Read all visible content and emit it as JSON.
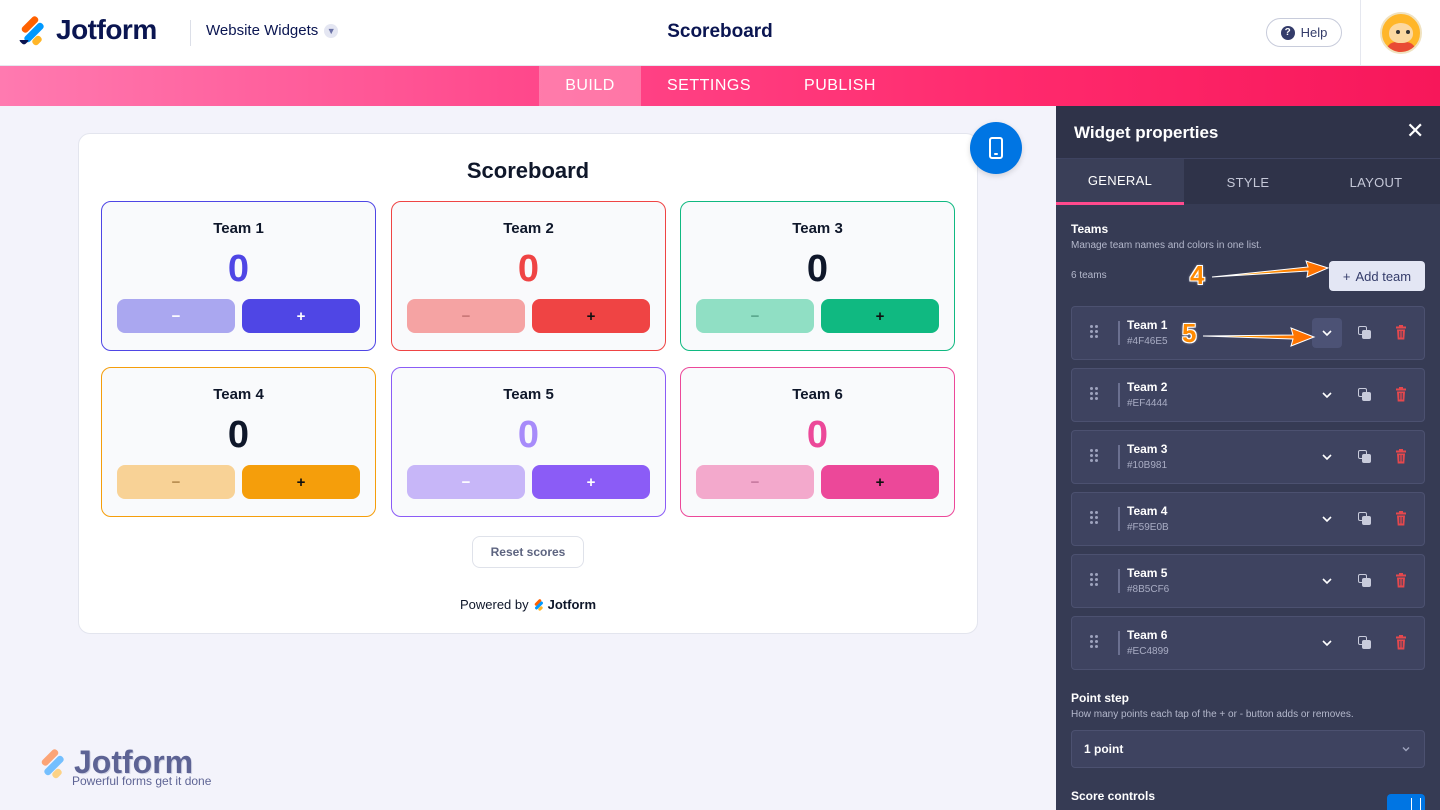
{
  "header": {
    "brand": "Jotform",
    "section": "Website Widgets",
    "title": "Scoreboard",
    "help_label": "Help"
  },
  "nav": {
    "tabs": [
      {
        "label": "BUILD",
        "active": true
      },
      {
        "label": "SETTINGS",
        "active": false
      },
      {
        "label": "PUBLISH",
        "active": false
      }
    ]
  },
  "widget": {
    "title": "Scoreboard",
    "teams": [
      {
        "name": "Team 1",
        "score": "0",
        "color": "#4F46E5",
        "minus": "−",
        "plus": "+"
      },
      {
        "name": "Team 2",
        "score": "0",
        "color": "#EF4444",
        "minus": "−",
        "plus": "+"
      },
      {
        "name": "Team 3",
        "score": "0",
        "color": "#10B981",
        "minus": "−",
        "plus": "+"
      },
      {
        "name": "Team 4",
        "score": "0",
        "color": "#F59E0B",
        "minus": "−",
        "plus": "+"
      },
      {
        "name": "Team 5",
        "score": "0",
        "color": "#8B5CF6",
        "minus": "−",
        "plus": "+"
      },
      {
        "name": "Team 6",
        "score": "0",
        "color": "#EC4899",
        "minus": "−",
        "plus": "+"
      }
    ],
    "reset_label": "Reset scores",
    "powered_prefix": "Powered by",
    "powered_brand": "Jotform"
  },
  "watermark": {
    "brand": "Jotform",
    "tagline": "Powerful forms get it done"
  },
  "panel": {
    "title": "Widget properties",
    "tabs": [
      {
        "label": "GENERAL",
        "active": true
      },
      {
        "label": "STYLE",
        "active": false
      },
      {
        "label": "LAYOUT",
        "active": false
      }
    ],
    "teams_section": {
      "title": "Teams",
      "subtitle": "Manage team names and colors in one list.",
      "count": "6 teams",
      "add_label": "Add team"
    },
    "team_rows": [
      {
        "name": "Team 1",
        "hex": "#4F46E5"
      },
      {
        "name": "Team 2",
        "hex": "#EF4444"
      },
      {
        "name": "Team 3",
        "hex": "#10B981"
      },
      {
        "name": "Team 4",
        "hex": "#F59E0B"
      },
      {
        "name": "Team 5",
        "hex": "#8B5CF6"
      },
      {
        "name": "Team 6",
        "hex": "#EC4899"
      }
    ],
    "point_step": {
      "title": "Point step",
      "subtitle": "How many points each tap of the + or - button adds or removes.",
      "value": "1 point"
    },
    "score_controls": {
      "title": "Score controls",
      "enabled": true
    }
  },
  "annotations": {
    "callout_4": "4",
    "callout_5": "5",
    "color": "#FF8A00"
  }
}
